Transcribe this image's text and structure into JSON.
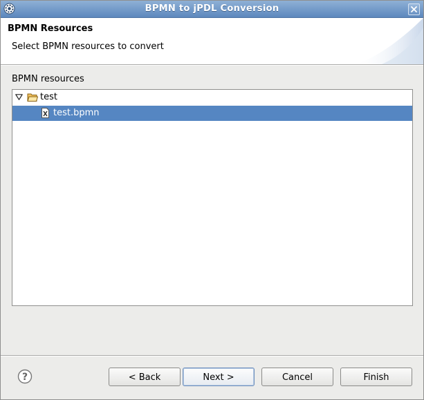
{
  "window": {
    "title": "BPMN to jPDL Conversion"
  },
  "header": {
    "title": "BPMN Resources",
    "description": "Select BPMN resources to convert"
  },
  "resources": {
    "label": "BPMN resources",
    "tree": [
      {
        "label": "test",
        "type": "folder",
        "expanded": true,
        "icon": "folder-open-icon"
      },
      {
        "label": "test.bpmn",
        "type": "file",
        "selected": true,
        "icon": "xml-file-icon"
      }
    ]
  },
  "buttons": {
    "back": "< Back",
    "next": "Next >",
    "cancel": "Cancel",
    "finish": "Finish"
  },
  "colors": {
    "titlebar": "#6f97c8",
    "selection": "#5586c2",
    "background": "#ececea"
  }
}
